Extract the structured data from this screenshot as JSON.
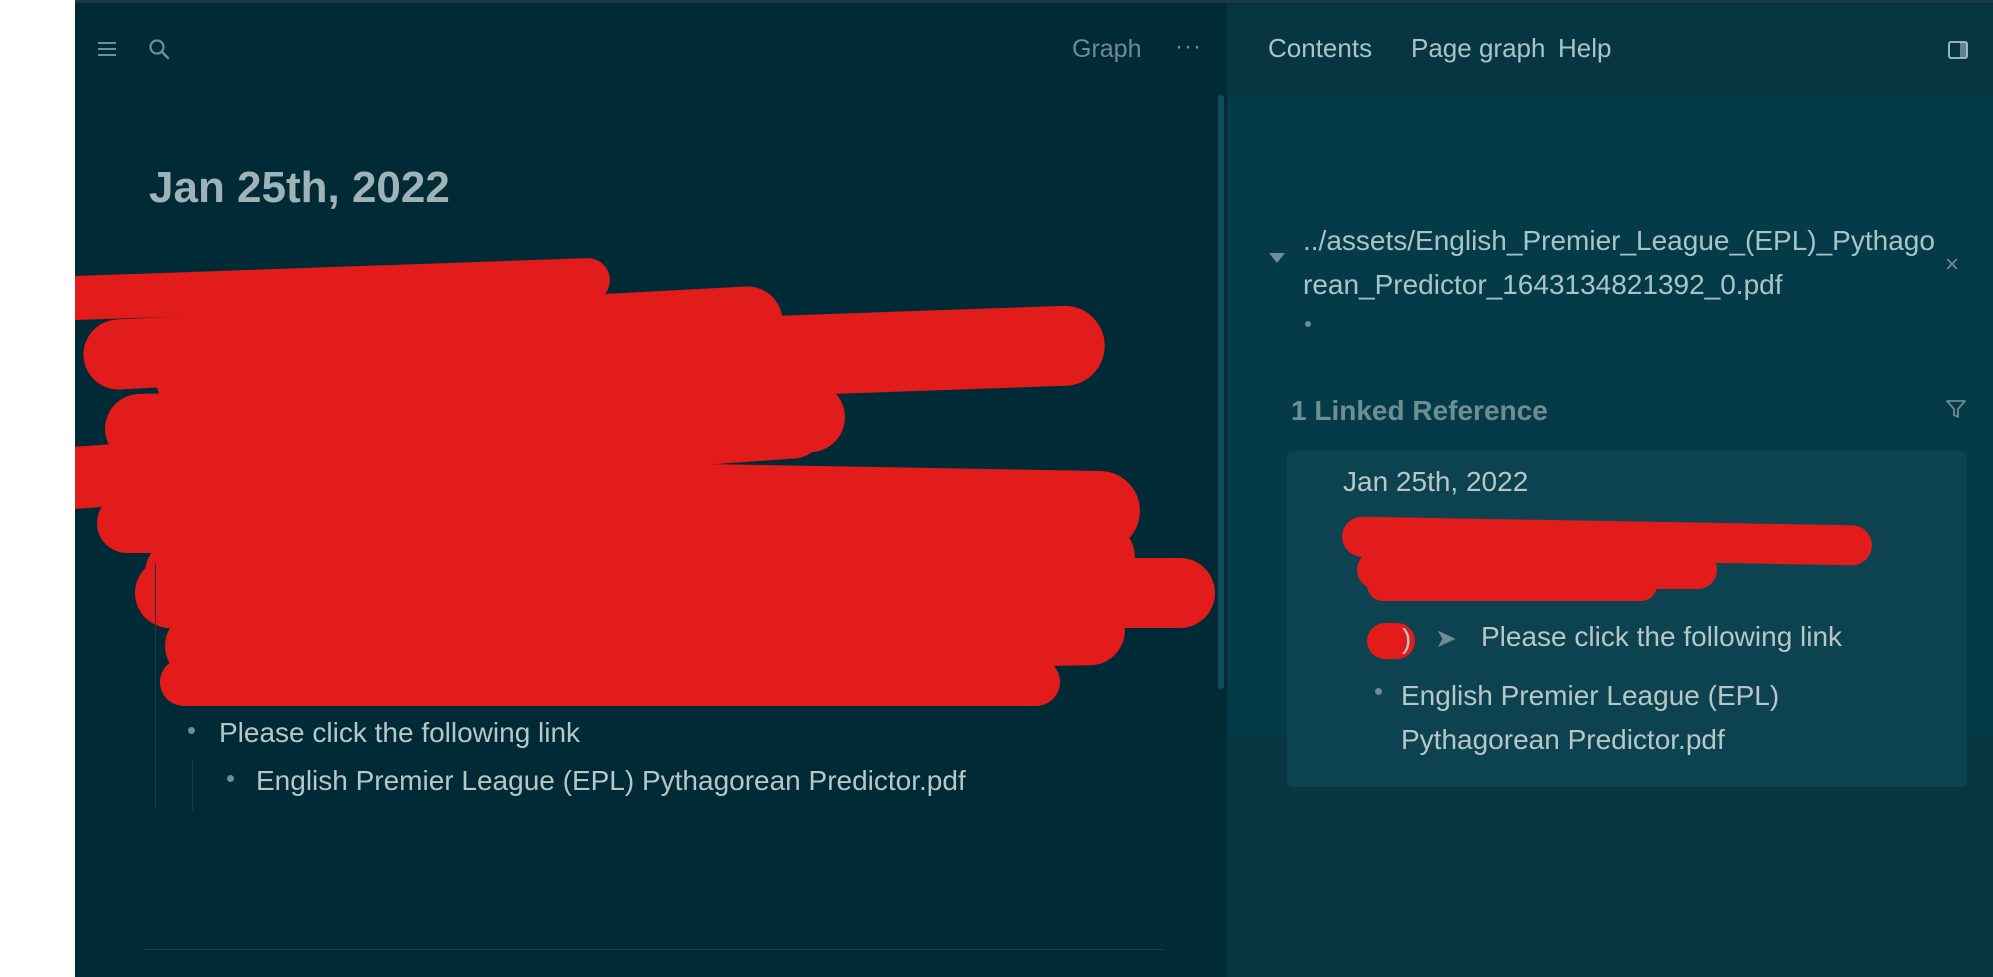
{
  "page": {
    "title": "Jan 25th, 2022"
  },
  "topbar": {
    "graph_label": "Graph",
    "more_label": "···"
  },
  "main": {
    "blocks": [
      {
        "text": "Please click the following link"
      },
      {
        "text": "English Premier League (EPL) Pythagorean Predictor.pdf"
      }
    ]
  },
  "sidebar": {
    "tabs": [
      "Contents",
      "Page graph",
      "Help"
    ],
    "ref_path": "../assets/English_Premier_League_(EPL)_Pythagorean_Predictor_1643134821392_0.pdf",
    "close_label": "×",
    "linked": {
      "title": "1 Linked Reference",
      "date": "Jan 25th, 2022",
      "paren": ")",
      "arrow": "➤",
      "line": "Please click the following link",
      "file": "English Premier League (EPL) Pythagorean Predictor.pdf"
    }
  },
  "colors": {
    "background": "#002b36",
    "sidebar": "#073642",
    "text": "#b7c6c6",
    "redaction": "#e21b1b"
  },
  "icons": [
    "menu-icon",
    "search-icon",
    "toggle-sidebar-icon",
    "close-icon",
    "filter-icon",
    "caret-down-icon"
  ]
}
